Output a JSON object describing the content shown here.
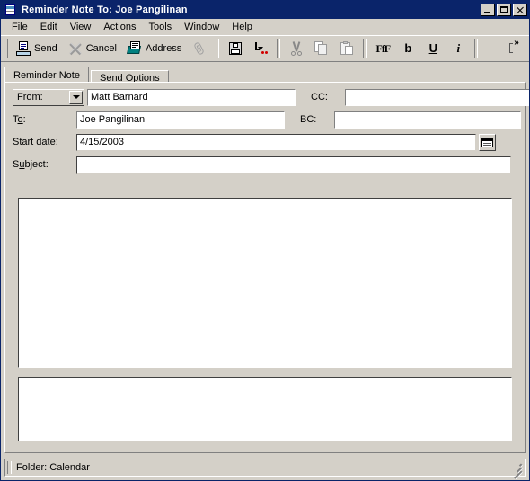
{
  "window": {
    "title": "Reminder Note To: Joe Pangilinan",
    "icon": "note-document-icon",
    "controls": {
      "minimize": "Minimize",
      "maximize": "Maximize",
      "close": "Close"
    }
  },
  "menubar": {
    "items": [
      {
        "label": "File",
        "accel": "F"
      },
      {
        "label": "Edit",
        "accel": "E"
      },
      {
        "label": "View",
        "accel": "V"
      },
      {
        "label": "Actions",
        "accel": "A"
      },
      {
        "label": "Tools",
        "accel": "T"
      },
      {
        "label": "Window",
        "accel": "W"
      },
      {
        "label": "Help",
        "accel": "H"
      }
    ]
  },
  "toolbar": {
    "send_label": "Send",
    "cancel_label": "Cancel",
    "address_label": "Address",
    "attach_label": "Attach",
    "save_label": "Save",
    "send_later_label": "Send Later",
    "cut_label": "Cut",
    "copy_label": "Copy",
    "paste_label": "Paste",
    "font_label": "FfF",
    "bold_label": "b",
    "underline_label": "U",
    "italic_label": "i",
    "overflow_label": "»"
  },
  "tabs": [
    {
      "label": "Reminder Note",
      "active": true
    },
    {
      "label": "Send Options",
      "active": false
    }
  ],
  "form": {
    "from": {
      "label": "From:",
      "value": "Matt Barnard",
      "placeholder": ""
    },
    "to": {
      "label_pre": "T",
      "label_accel": "o",
      "label_post": ":",
      "value": "Joe Pangilinan",
      "placeholder": ""
    },
    "cc": {
      "label": "CC:",
      "value": "",
      "placeholder": ""
    },
    "bc": {
      "label": "BC:",
      "value": "",
      "placeholder": ""
    },
    "start_date": {
      "label": "Start date:",
      "value": "4/15/2003",
      "placeholder": ""
    },
    "subject": {
      "label_pre": "S",
      "label_accel": "u",
      "label_post": "bject:",
      "value": "",
      "placeholder": ""
    },
    "body": {
      "value": "",
      "placeholder": ""
    },
    "footer": {
      "value": "",
      "placeholder": ""
    }
  },
  "statusbar": {
    "text": "Folder: Calendar"
  },
  "colors": {
    "titlebar": "#0a246a",
    "face": "#d4d0c8",
    "field": "#ffffff",
    "shadow": "#808080",
    "accent_teal": "#008080",
    "accent_red": "#d00000"
  }
}
